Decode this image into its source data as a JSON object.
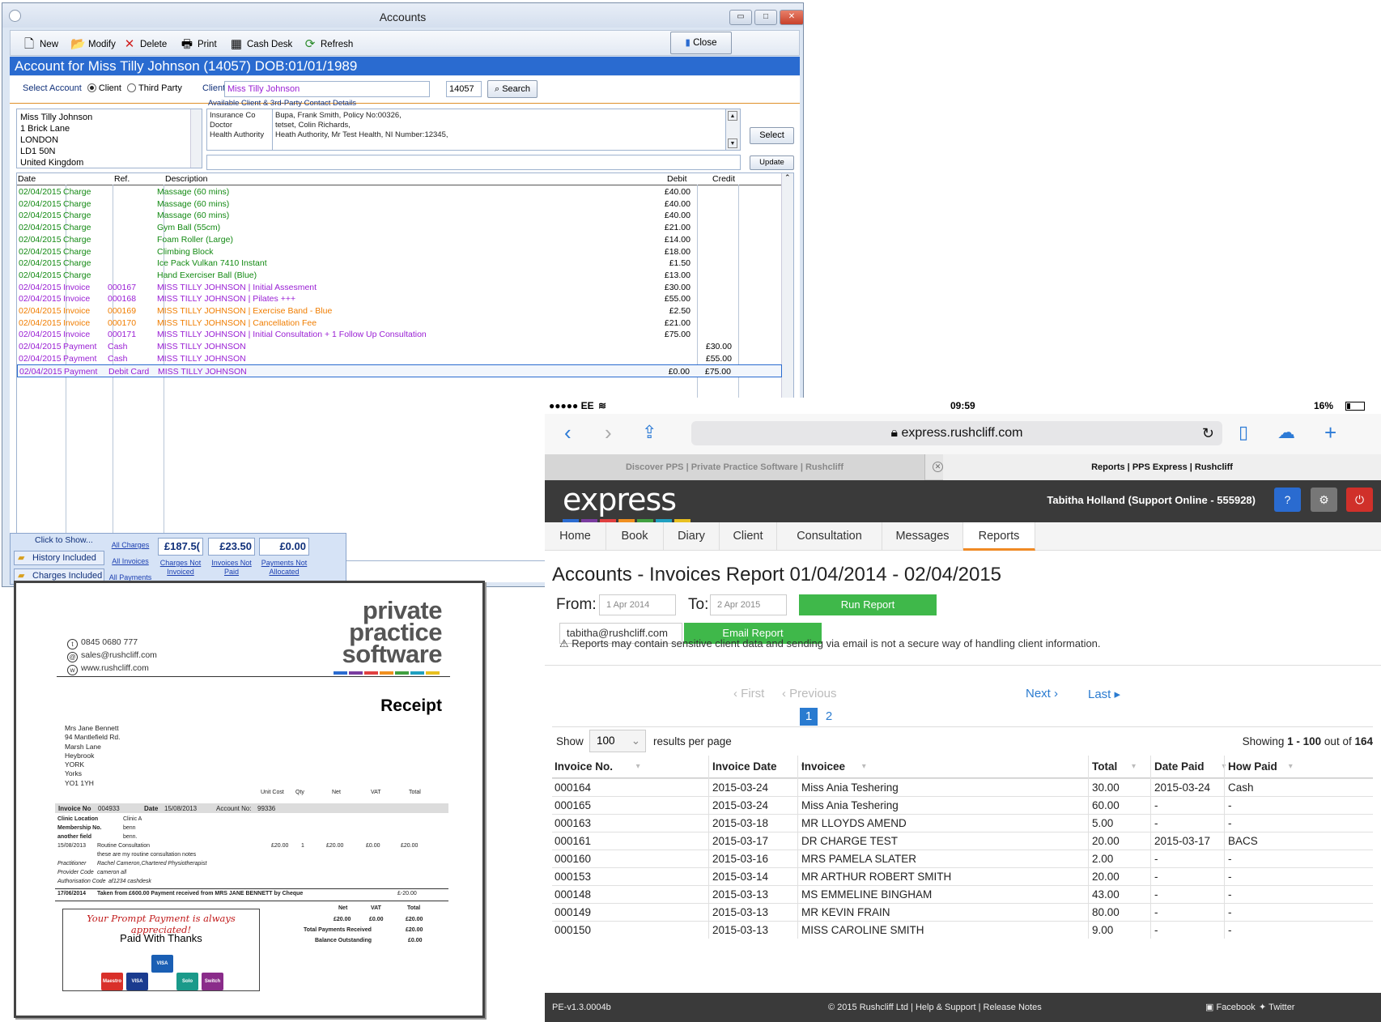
{
  "window": {
    "title": "Accounts",
    "min": "▭",
    "max": "□",
    "close": "✕",
    "toolbar": [
      {
        "label": "New",
        "icon": "new-doc-icon",
        "glyph": "🗋"
      },
      {
        "label": "Modify",
        "icon": "folder-open-icon",
        "glyph": "📂"
      },
      {
        "label": "Delete",
        "icon": "delete-x-icon",
        "glyph": "✕"
      },
      {
        "label": "Print",
        "icon": "printer-icon",
        "glyph": "🖶"
      },
      {
        "label": "Cash Desk",
        "icon": "cash-desk-icon",
        "glyph": "▦"
      },
      {
        "label": "Refresh",
        "icon": "refresh-icon",
        "glyph": "⟳"
      }
    ],
    "close_label": "Close",
    "header": "Account for Miss Tilly Johnson (14057) DOB:01/01/1989",
    "select_account": "Select Account",
    "opt_client": "Client",
    "opt_third": "Third Party",
    "client_label": "Client",
    "client_value": "Miss Tilly Johnson",
    "client_id": "14057",
    "search": "Search",
    "address": [
      "Miss Tilly Johnson",
      "1 Brick Lane",
      "LONDON",
      "LD1 50N",
      "United Kingdom"
    ],
    "contacts_title": "Available Client & 3rd-Party Contact Details",
    "contacts": [
      {
        "type": "Insurance Co",
        "detail": "Bupa, Frank Smith, Policy No:00326,"
      },
      {
        "type": "Doctor",
        "detail": "tetset, Colin Richards,"
      },
      {
        "type": "Health Authority",
        "detail": "Heath Authority, Mr Test Health, NI Number:12345,"
      }
    ],
    "select_btn": "Select",
    "update_btn": "Update",
    "cols": {
      "date": "Date",
      "ref": "Ref.",
      "desc": "Description",
      "debit": "Debit",
      "credit": "Credit"
    },
    "rows": [
      {
        "date": "02/04/2015",
        "type": "Charge",
        "ref": "",
        "desc": "Massage (60 mins)",
        "debit": "£40.00",
        "credit": "",
        "color": "#138a13"
      },
      {
        "date": "02/04/2015",
        "type": "Charge",
        "ref": "",
        "desc": "Massage (60 mins)",
        "debit": "£40.00",
        "credit": "",
        "color": "#138a13"
      },
      {
        "date": "02/04/2015",
        "type": "Charge",
        "ref": "",
        "desc": "Massage (60 mins)",
        "debit": "£40.00",
        "credit": "",
        "color": "#138a13"
      },
      {
        "date": "02/04/2015",
        "type": "Charge",
        "ref": "",
        "desc": "Gym Ball (55cm)",
        "debit": "£21.00",
        "credit": "",
        "color": "#138a13"
      },
      {
        "date": "02/04/2015",
        "type": "Charge",
        "ref": "",
        "desc": "Foam Roller (Large)",
        "debit": "£14.00",
        "credit": "",
        "color": "#138a13"
      },
      {
        "date": "02/04/2015",
        "type": "Charge",
        "ref": "",
        "desc": "Climbing Block",
        "debit": "£18.00",
        "credit": "",
        "color": "#138a13"
      },
      {
        "date": "02/04/2015",
        "type": "Charge",
        "ref": "",
        "desc": "Ice Pack Vulkan 7410 Instant",
        "debit": "£1.50",
        "credit": "",
        "color": "#138a13"
      },
      {
        "date": "02/04/2015",
        "type": "Charge",
        "ref": "",
        "desc": "Hand Exerciser Ball (Blue)",
        "debit": "£13.00",
        "credit": "",
        "color": "#138a13"
      },
      {
        "date": "02/04/2015",
        "type": "Invoice",
        "ref": "000167",
        "desc": "MISS TILLY JOHNSON | Initial Assesment",
        "debit": "£30.00",
        "credit": "",
        "color": "#9a1fd4"
      },
      {
        "date": "02/04/2015",
        "type": "Invoice",
        "ref": "000168",
        "desc": "MISS TILLY JOHNSON | Pilates +++",
        "debit": "£55.00",
        "credit": "",
        "color": "#9a1fd4"
      },
      {
        "date": "02/04/2015",
        "type": "Invoice",
        "ref": "000169",
        "desc": "MISS TILLY JOHNSON | Exercise Band - Blue",
        "debit": "£2.50",
        "credit": "",
        "color": "#f07d00"
      },
      {
        "date": "02/04/2015",
        "type": "Invoice",
        "ref": "000170",
        "desc": "MISS TILLY JOHNSON | Cancellation Fee",
        "debit": "£21.00",
        "credit": "",
        "color": "#f07d00"
      },
      {
        "date": "02/04/2015",
        "type": "Invoice",
        "ref": "000171",
        "desc": "MISS TILLY JOHNSON | Initial Consultation + 1 Follow Up Consultation",
        "debit": "£75.00",
        "credit": "",
        "color": "#9a1fd4"
      },
      {
        "date": "02/04/2015",
        "type": "Payment",
        "ref": "Cash",
        "desc": "MISS TILLY JOHNSON",
        "debit": "",
        "credit": "£30.00",
        "color": "#9a1fd4"
      },
      {
        "date": "02/04/2015",
        "type": "Payment",
        "ref": "Cash",
        "desc": "MISS TILLY JOHNSON",
        "debit": "",
        "credit": "£55.00",
        "color": "#9a1fd4"
      },
      {
        "date": "02/04/2015",
        "type": "Payment",
        "ref": "Debit Card",
        "desc": "MISS TILLY JOHNSON",
        "debit": "£0.00",
        "credit": "£75.00",
        "color": "#9a1fd4"
      }
    ],
    "click_to_show": "Click to Show...",
    "history_included": "History Included",
    "charges_included": "Charges Included",
    "all_charges": "All Charges",
    "all_invoices": "All Invoices",
    "all_payments": "All Payments",
    "totals": [
      {
        "value": "£187.5(",
        "label": "Charges Not Invoiced"
      },
      {
        "value": "£23.50",
        "label": "Invoices Not Paid"
      },
      {
        "value": "£0.00",
        "label": "Payments Not Allocated"
      }
    ]
  },
  "receipt": {
    "logo": [
      "private",
      "practice",
      "software"
    ],
    "phone": "0845 0680 777",
    "email": "sales@rushcliff.com",
    "web": "www.rushcliff.com",
    "title": "Receipt",
    "address": [
      "Mrs Jane Bennett",
      "94 Mantlefield Rd.",
      "Marsh Lane",
      "Heybrook",
      "YORK",
      "Yorks",
      "YO1 1YH"
    ],
    "hdr": {
      "unit": "Unit Cost",
      "qty": "Qty",
      "net": "Net",
      "vat": "VAT",
      "total": "Total"
    },
    "invoice_no_lbl": "Invoice No",
    "invoice_no": "004933",
    "date_lbl": "Date",
    "date": "15/08/2013",
    "account_lbl": "Account No:",
    "account": "99336",
    "clinic_lbl": "Clinic Location",
    "clinic": "Clinic A",
    "member_lbl": "Membership No.",
    "member": "benn",
    "another_lbl": "another field",
    "another": "benn.",
    "line_date": "15/08/2013",
    "line_desc": "Routine Consultation",
    "line_unit": "£20.00",
    "line_qty": "1",
    "line_net": "£20.00",
    "line_vat": "£0.00",
    "line_total": "£20.00",
    "note": "these are my routine consultation notes",
    "pract_lbl": "Practitioner",
    "pract": "Rachel Cameron,Chartered Physiotherapist",
    "prov_lbl": "Provider Code",
    "prov": "cameron all",
    "auth_lbl": "Authorisation Code",
    "auth": "af1234 cashdesk",
    "pay_date": "17/06/2014",
    "pay_text": "Taken from £600.00 Payment received from MRS JANE BENNETT by Cheque",
    "pay_amt": "£-20.00",
    "sum_net_lbl": "Net",
    "sum_vat_lbl": "VAT",
    "sum_total_lbl": "Total",
    "sum_net": "£20.00",
    "sum_vat": "£0.00",
    "sum_total": "£20.00",
    "tpr_lbl": "Total Payments Received",
    "tpr": "£20.00",
    "bal_lbl": "Balance Outstanding",
    "bal": "£0.00",
    "prompt": "Your Prompt Payment is always appreciated!",
    "paid": "Paid With Thanks",
    "cards": [
      {
        "name": "Maestro",
        "color": "#d9302a"
      },
      {
        "name": "VISA",
        "color": "#1a3b8f"
      },
      {
        "name": "VISA Electron",
        "color": "#1a5fb4"
      },
      {
        "name": "Solo",
        "color": "#1a9a8a"
      },
      {
        "name": "Switch",
        "color": "#8a2c8a"
      }
    ]
  },
  "ipad": {
    "carrier": "●●●●● EE",
    "time": "09:59",
    "battery": "16%",
    "url": "express.rushcliff.com",
    "tab1": "Discover PPS | Private Practice Software | Rushcliff",
    "tab2": "Reports | PPS Express | Rushcliff",
    "logo": "express",
    "user": "Tabitha Holland (Support Online - 555928)",
    "menu": [
      "Home",
      "Book",
      "Diary",
      "Client",
      "Consultation",
      "Messages",
      "Reports"
    ],
    "report_title": "Accounts - Invoices Report 01/04/2014 - 02/04/2015",
    "from_lbl": "From:",
    "from_val": "1 Apr 2014",
    "to_lbl": "To:",
    "to_val": "2 Apr 2015",
    "run": "Run Report",
    "email_val": "tabitha@rushcliff.com",
    "email_btn": "Email Report",
    "warning": "Reports may contain sensitive client data and sending via email is not a secure way of handling client information.",
    "first": "‹ First",
    "previous": "‹ Previous",
    "next": "Next ›",
    "last": "Last ▸",
    "page1": "1",
    "page2": "2",
    "show": "Show",
    "per_page": "100",
    "results_per_page": "results per page",
    "showing": "Showing",
    "showing_range": "1 - 100",
    "showing_of": "out of",
    "showing_total": "164",
    "cols": [
      "Invoice No.",
      "Invoice Date",
      "Invoicee",
      "Total",
      "Date Paid",
      "How Paid"
    ],
    "rows": [
      [
        "000164",
        "2015-03-24",
        "Miss Ania Teshering",
        "30.00",
        "2015-03-24",
        "Cash"
      ],
      [
        "000165",
        "2015-03-24",
        "Miss Ania Teshering",
        "60.00",
        "-",
        "-"
      ],
      [
        "000163",
        "2015-03-18",
        "MR LLOYDS AMEND",
        "5.00",
        "-",
        "-"
      ],
      [
        "000161",
        "2015-03-17",
        "DR CHARGE TEST",
        "20.00",
        "2015-03-17",
        "BACS"
      ],
      [
        "000160",
        "2015-03-16",
        "MRS PAMELA SLATER",
        "2.00",
        "-",
        "-"
      ],
      [
        "000153",
        "2015-03-14",
        "MR ARTHUR ROBERT SMITH",
        "20.00",
        "-",
        "-"
      ],
      [
        "000148",
        "2015-03-13",
        "MS EMMELINE BINGHAM",
        "43.00",
        "-",
        "-"
      ],
      [
        "000149",
        "2015-03-13",
        "MR KEVIN FRAIN",
        "80.00",
        "-",
        "-"
      ],
      [
        "000150",
        "2015-03-13",
        "MISS CAROLINE SMITH",
        "9.00",
        "-",
        "-"
      ]
    ],
    "version": "PE-v1.3.0004b",
    "copyright": "© 2015 Rushcliff Ltd | Help & Support | Release Notes",
    "facebook": "Facebook",
    "twitter": "Twitter"
  }
}
